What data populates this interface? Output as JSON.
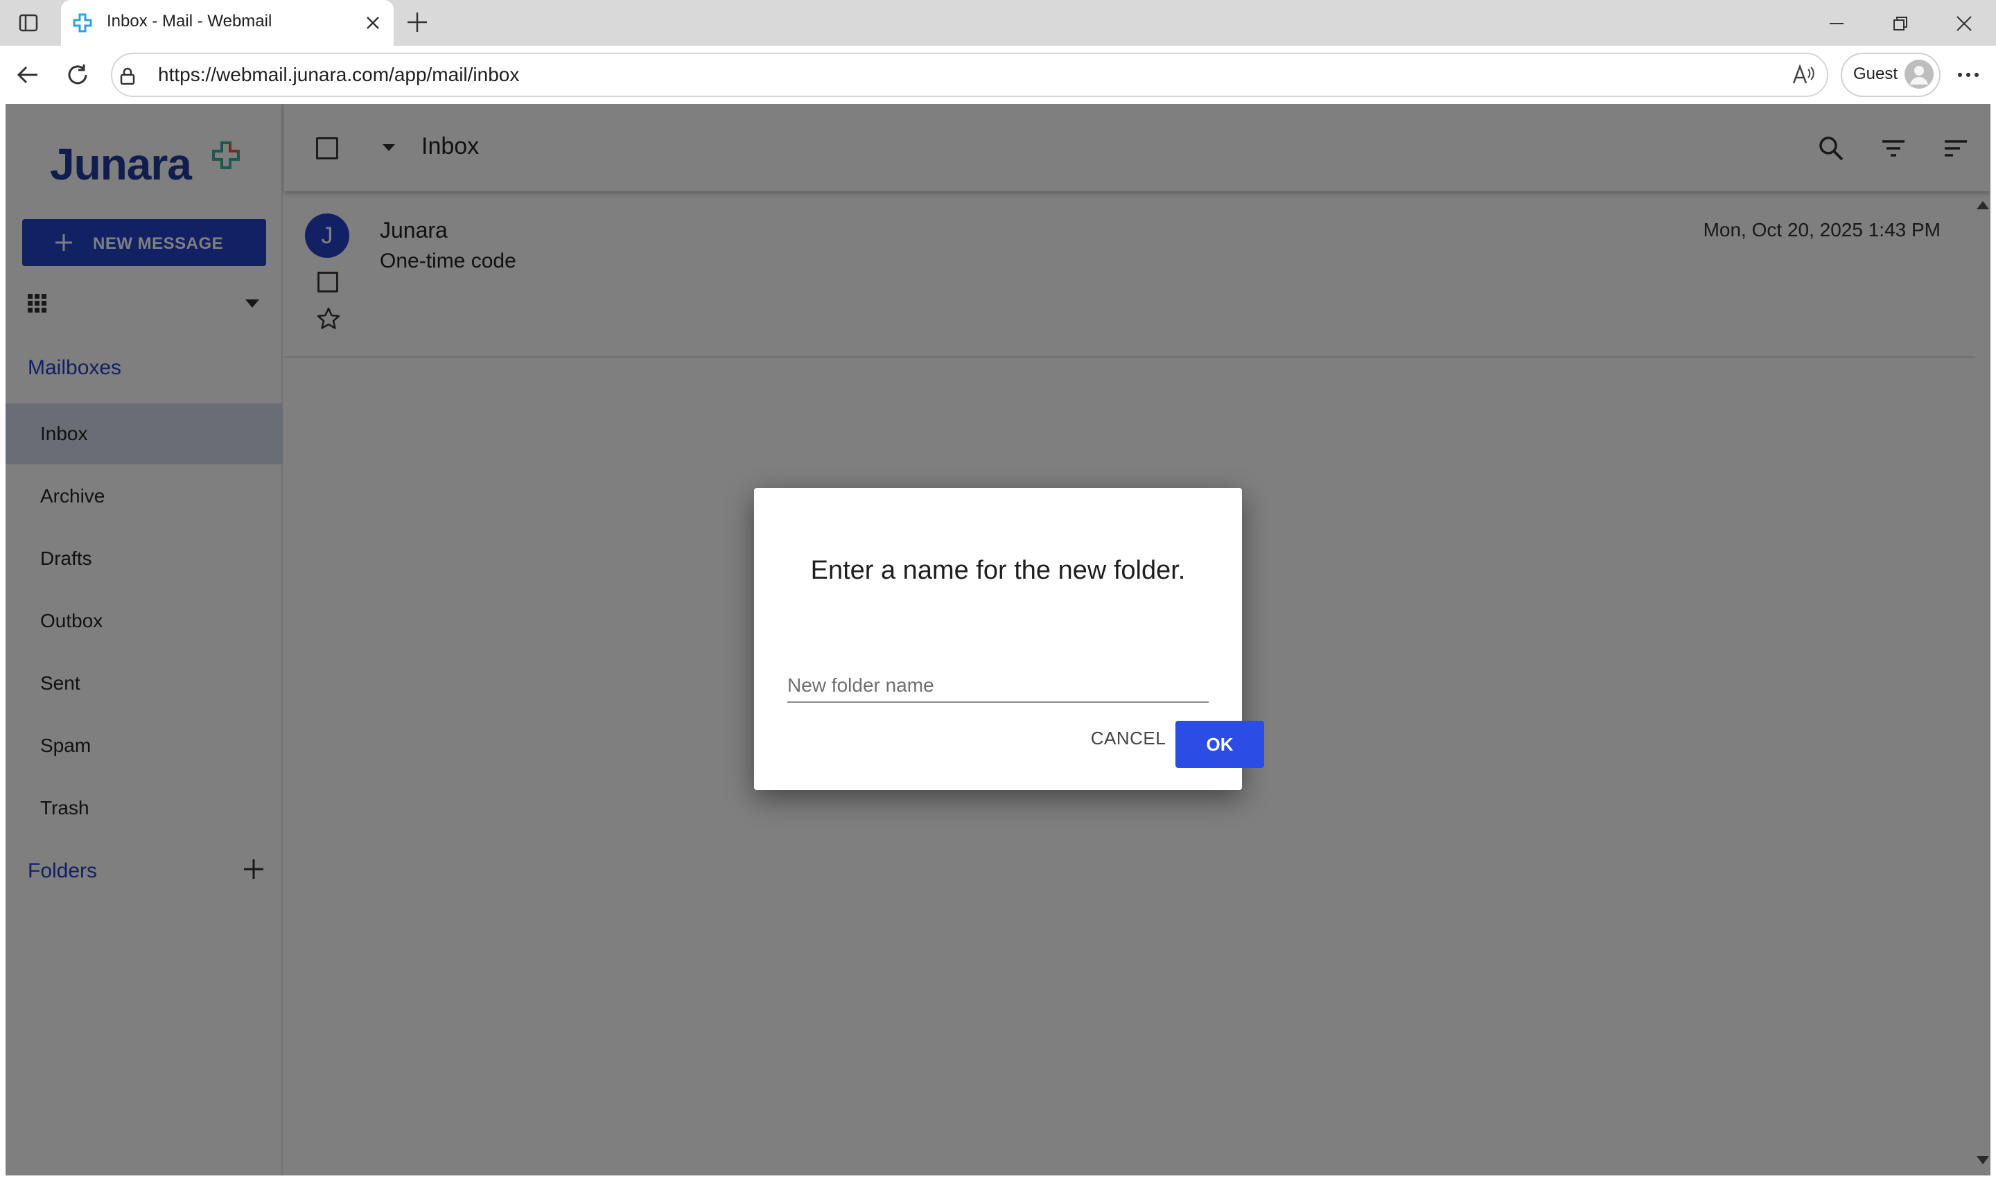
{
  "browser": {
    "tab_title": "Inbox - Mail - Webmail",
    "url": "https://webmail.junara.com/app/mail/inbox",
    "profile_label": "Guest"
  },
  "sidebar": {
    "logo_text": "Junara",
    "new_message_label": "NEW MESSAGE",
    "mailboxes_title": "Mailboxes",
    "mailboxes": [
      {
        "label": "Inbox",
        "active": true
      },
      {
        "label": "Archive"
      },
      {
        "label": "Drafts"
      },
      {
        "label": "Outbox"
      },
      {
        "label": "Sent"
      },
      {
        "label": "Spam"
      },
      {
        "label": "Trash"
      }
    ],
    "folders_title": "Folders"
  },
  "main": {
    "title": "Inbox",
    "messages": [
      {
        "avatar_letter": "J",
        "sender": "Junara",
        "subject": "One-time code",
        "date": "Mon, Oct 20, 2025 1:43 PM"
      }
    ]
  },
  "dialog": {
    "title": "Enter a name for the new folder.",
    "input_placeholder": "New folder name",
    "input_value": "",
    "cancel_label": "CANCEL",
    "ok_label": "OK"
  },
  "colors": {
    "brand_blue": "#2540c9",
    "ok_button": "#2b4de6",
    "overlay": "rgba(0,0,0,0.5)"
  }
}
